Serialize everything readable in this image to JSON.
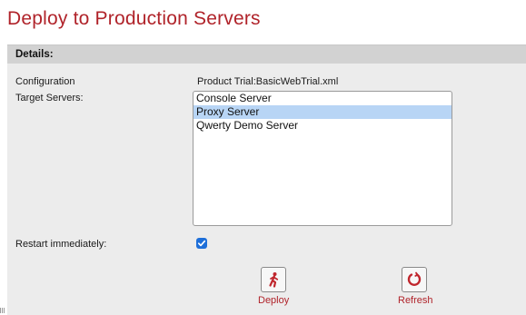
{
  "page": {
    "title": "Deploy to Production Servers"
  },
  "details": {
    "header": "Details:",
    "configuration_label": "Configuration",
    "configuration_value": "Product Trial:BasicWebTrial.xml",
    "target_servers_label": "Target Servers:",
    "servers": [
      {
        "name": "Console Server",
        "selected": false
      },
      {
        "name": "Proxy Server",
        "selected": true
      },
      {
        "name": "Qwerty Demo Server",
        "selected": false
      }
    ],
    "restart_label": "Restart immediately:",
    "restart_checked": true
  },
  "actions": {
    "deploy": {
      "label": "Deploy",
      "icon": "running-person-icon"
    },
    "refresh": {
      "label": "Refresh",
      "icon": "refresh-icon"
    }
  },
  "colors": {
    "title": "#b0232a",
    "header_bg": "#d2d2d2",
    "panel_bg": "#ececec",
    "selection": "#b8d5f5",
    "checkbox": "#1e6fd9"
  }
}
